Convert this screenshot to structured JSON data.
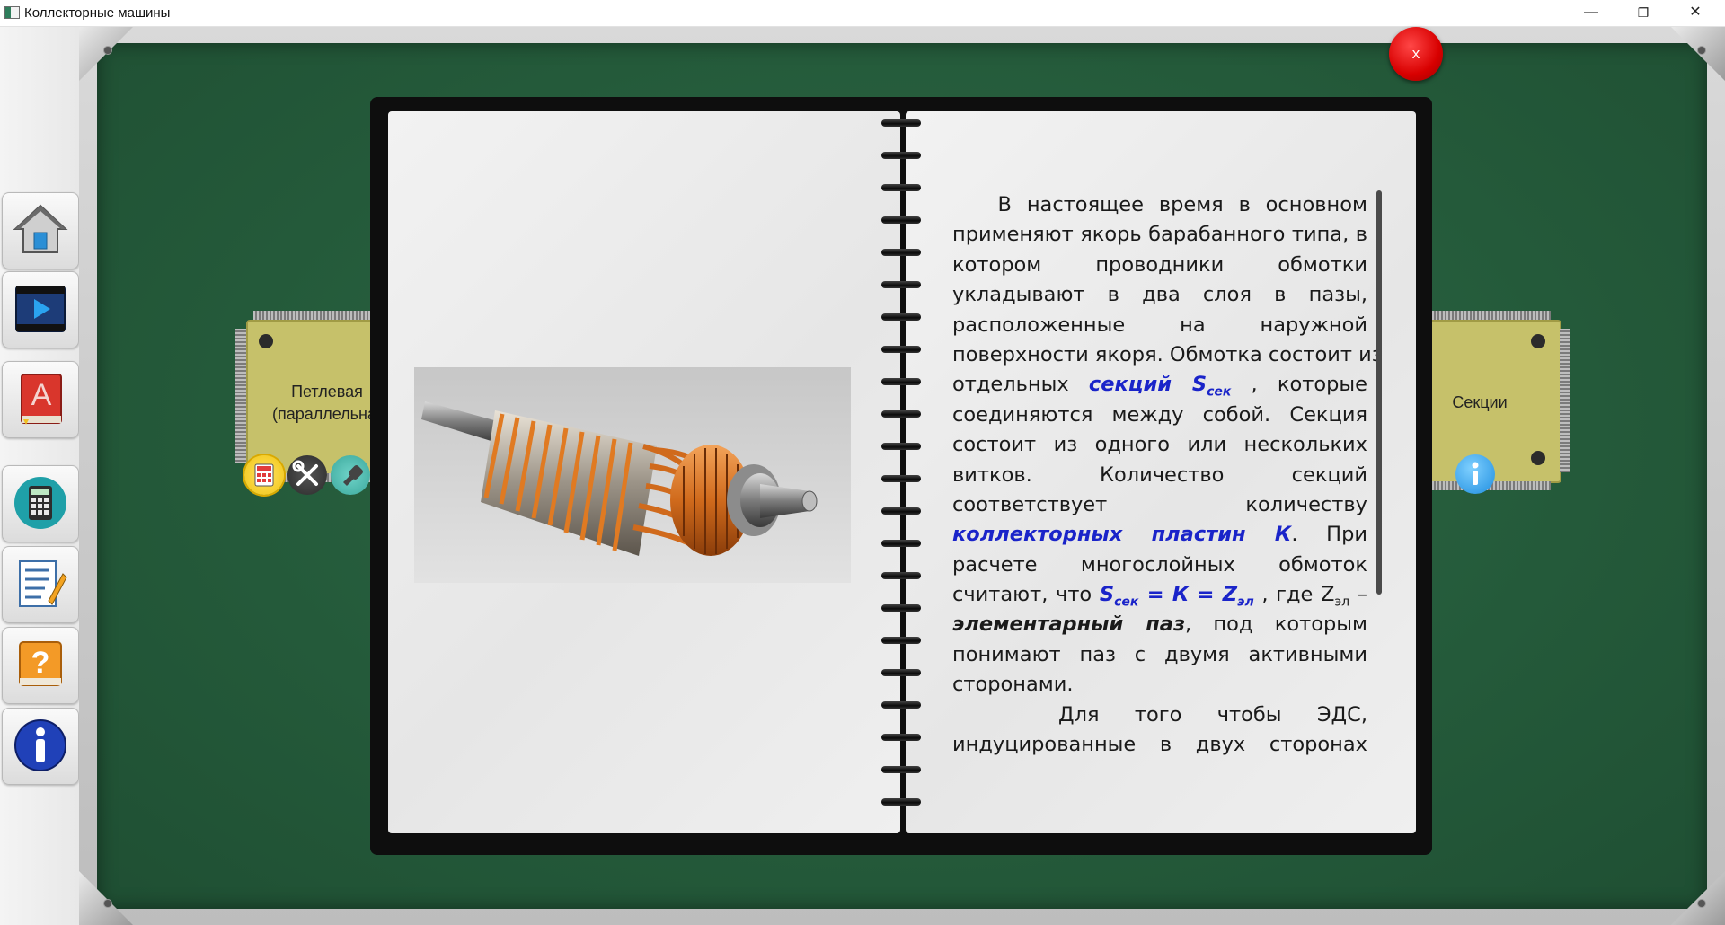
{
  "window": {
    "title": "Коллекторные машины",
    "minimize": "—",
    "restore": "❐",
    "close": "✕"
  },
  "sidebar": {
    "buttons": [
      {
        "icon": "home-icon"
      },
      {
        "icon": "video-icon"
      },
      {
        "icon": "book-icon"
      },
      {
        "icon": "calculator-icon"
      },
      {
        "icon": "test-icon"
      },
      {
        "icon": "help-icon"
      },
      {
        "icon": "info-icon"
      }
    ]
  },
  "left_chip": {
    "line1": "Петлевая",
    "line2": "(параллельна",
    "tools": [
      "calculator-icon",
      "tools-icon",
      "plug-icon"
    ]
  },
  "right_chip": {
    "label": "Секции",
    "tool": "info-icon"
  },
  "close_button": "x",
  "book": {
    "image_alt": "armature-photo",
    "lines": [
      [
        "   В настоящее время в основном"
      ],
      [
        "применяют якорь барабанного типа, в"
      ],
      [
        "котором проводники обмотки"
      ],
      [
        "укладывают в два слоя в пазы,"
      ],
      [
        "расположенные на наружной"
      ],
      [
        "поверхности якоря. Обмотка состоит из"
      ]
    ],
    "l7_a": "отдельных ",
    "l7_hl": "секций S",
    "l7_sub": "сек",
    "l7_b": " , которые",
    "l8": "соединяются между собой. Секция",
    "l9": "состоит из одного или нескольких",
    "l10": "витков. Количество секций",
    "l11": "соответствует количеству",
    "l12_hl": "коллекторных пластин К",
    "l12_b": ". При",
    "l13": "расчете многослойных обмоток",
    "l14_a": "считают, что ",
    "l14_f1": "S",
    "l14_s1": "сек",
    "l14_f2": " = К = Z",
    "l14_s2": "эл",
    "l14_b": " , где Z",
    "l14_s3": "эл",
    "l14_c": " –",
    "l15_bi": "элементарный паз",
    "l15_b": ", под которым",
    "l16": "понимают паз с двумя активными",
    "l17": "сторонами.",
    "l18": "   Для того чтобы ЭДС,",
    "l19": "индуцированные в двух сторонах"
  }
}
